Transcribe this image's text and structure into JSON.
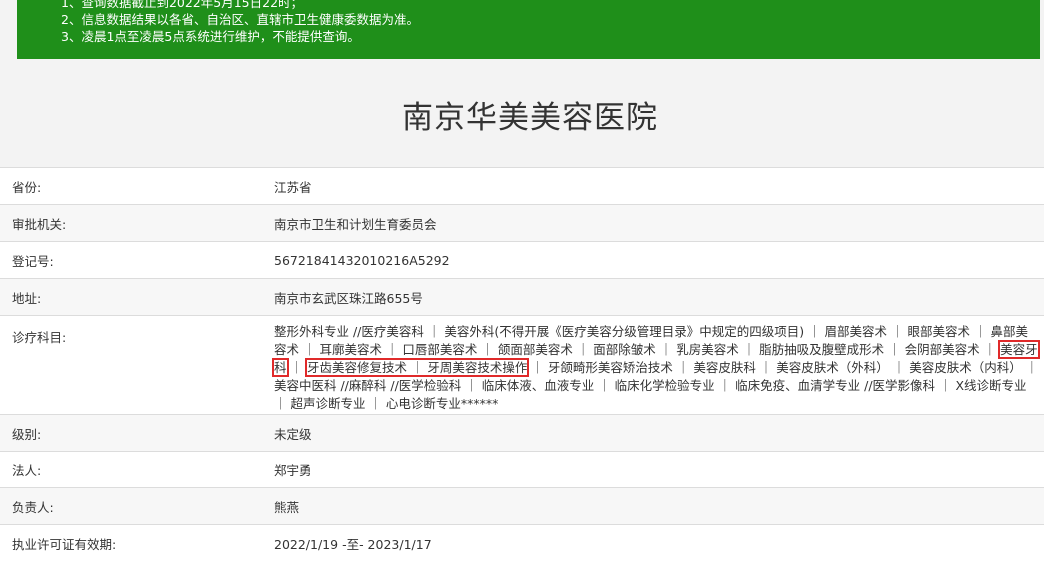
{
  "notice": {
    "lines": [
      "1、查询数据截止到2022年5月15日22时；",
      "2、信息数据结果以各省、自治区、直辖市卫生健康委数据为准。",
      "3、凌晨1点至凌晨5点系统进行维护，不能提供查询。"
    ]
  },
  "title": "南京华美美容医院",
  "rows": {
    "province": {
      "label": "省份:",
      "value": "江苏省"
    },
    "authority": {
      "label": "审批机关:",
      "value": "南京市卫生和计划生育委员会"
    },
    "reg_no": {
      "label": "登记号:",
      "value": "56721841432010216A5292"
    },
    "address": {
      "label": "地址:",
      "value": "南京市玄武区珠江路655号"
    },
    "subjects": {
      "label": "诊疗科目:",
      "part1": "整形外科专业 //医疗美容科 ｜ 美容外科(不得开展《医疗美容分级管理目录》中规定的四级项目) ｜ 眉部美容术 ｜ 眼部美容术 ｜ 鼻部美容术 ｜ 耳廓美容术 ｜ 口唇部美容术 ｜ 颌面部美容术 ｜ 面部除皱术 ｜ 乳房美容术 ｜ 脂肪抽吸及腹壁成形术 ｜ 会阴部美容术 ｜ ",
      "hl1": "美容牙科",
      "part2": " ｜ ",
      "hl2": "牙齿美容修复技术 ｜ 牙周美容技术操作",
      "part3": " ｜ 牙颌畸形美容矫治技术 ｜ 美容皮肤科 ｜ 美容皮肤术（外科） ｜ 美容皮肤术（内科） ｜ 美容中医科 //麻醉科 //医学检验科 ｜ 临床体液、血液专业 ｜ 临床化学检验专业 ｜ 临床免疫、血清学专业 //医学影像科 ｜ X线诊断专业 ｜ 超声诊断专业 ｜ 心电诊断专业******"
    },
    "level": {
      "label": "级别:",
      "value": "未定级"
    },
    "legal_person": {
      "label": "法人:",
      "value": "郑宇勇"
    },
    "principal": {
      "label": "负责人:",
      "value": "熊燕"
    },
    "validity": {
      "label": "执业许可证有效期:",
      "value": "2022/1/19 -至- 2023/1/17"
    }
  }
}
